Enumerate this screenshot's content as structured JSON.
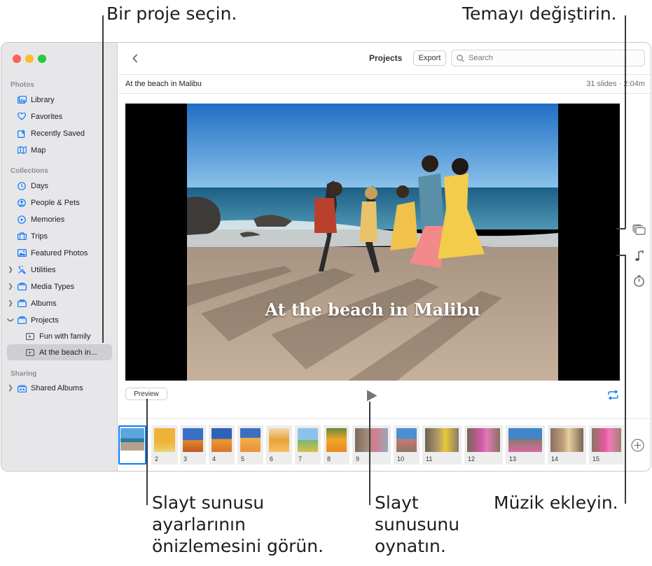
{
  "callouts": {
    "choose_project": "Bir proje seçin.",
    "change_theme": "Temayı değiştirin.",
    "preview_settings": "Slayt sunusu\nayarlarının\nönizlemesini görün.",
    "play": "Slayt\nsunusunu\noynatın.",
    "add_music": "Müzik ekleyin."
  },
  "sidebar": {
    "photos_head": "Photos",
    "photos": [
      {
        "label": "Library",
        "icon": "library-icon"
      },
      {
        "label": "Favorites",
        "icon": "heart-icon"
      },
      {
        "label": "Recently Saved",
        "icon": "recently-saved-icon"
      },
      {
        "label": "Map",
        "icon": "map-icon"
      }
    ],
    "collections_head": "Collections",
    "collections": [
      {
        "label": "Days",
        "icon": "clock-icon"
      },
      {
        "label": "People & Pets",
        "icon": "person-icon"
      },
      {
        "label": "Memories",
        "icon": "memories-icon"
      },
      {
        "label": "Trips",
        "icon": "suitcase-icon"
      },
      {
        "label": "Featured Photos",
        "icon": "featured-photos-icon"
      },
      {
        "label": "Utilities",
        "icon": "tools-icon"
      },
      {
        "label": "Media Types",
        "icon": "stack-icon"
      },
      {
        "label": "Albums",
        "icon": "stack-icon"
      },
      {
        "label": "Projects",
        "icon": "stack-icon"
      }
    ],
    "projects": [
      {
        "label": "Fun with family"
      },
      {
        "label": "At the beach in..."
      }
    ],
    "sharing_head": "Sharing",
    "shared_albums": "Shared Albums"
  },
  "toolbar": {
    "title": "Projects",
    "export": "Export",
    "search_placeholder": "Search"
  },
  "project": {
    "name": "At the beach in Malibu",
    "meta": "31 slides · 2:04m",
    "overlay_title": "At the beach in Malibu"
  },
  "controls": {
    "preview": "Preview"
  },
  "thumbnails": [
    "",
    "2",
    "3",
    "4",
    "5",
    "6",
    "7",
    "8",
    "9",
    "10",
    "11",
    "12",
    "13",
    "14",
    "15"
  ],
  "colors": {
    "accent": "#0a7aff",
    "sidebar_bg": "#e7e7e9",
    "close": "#fe5f57",
    "minimize": "#febc2e",
    "zoom": "#28c840"
  }
}
